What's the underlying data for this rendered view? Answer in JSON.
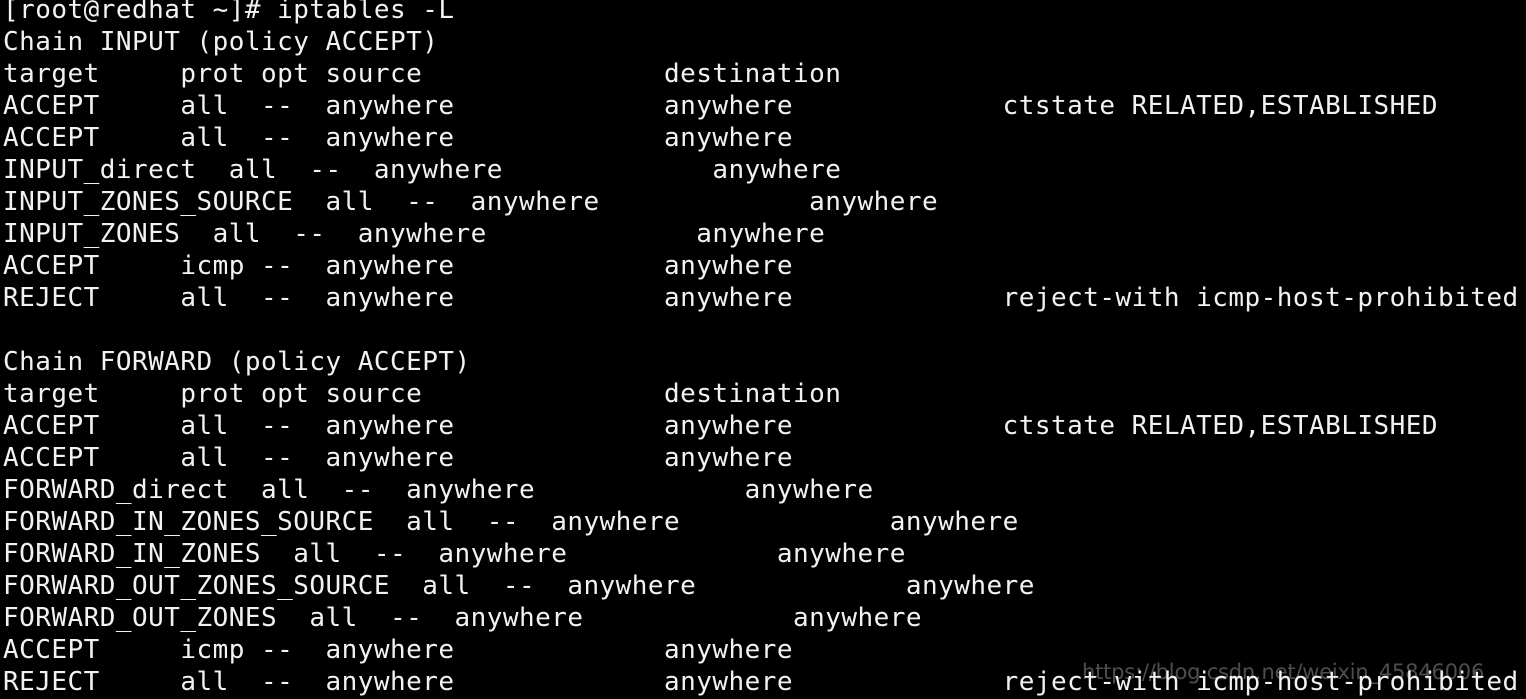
{
  "terminal": {
    "background_color": "#000000",
    "text_color": "#f2f2f2",
    "prompt": "[root@redhat ~]#",
    "command": "iptables -L",
    "lines": [
      "[root@redhat ~]# iptables -L",
      "Chain INPUT (policy ACCEPT)",
      "target     prot opt source               destination         ",
      "ACCEPT     all  --  anywhere             anywhere             ctstate RELATED,ESTABLISHED",
      "ACCEPT     all  --  anywhere             anywhere            ",
      "INPUT_direct  all  --  anywhere             anywhere          ",
      "INPUT_ZONES_SOURCE  all  --  anywhere             anywhere    ",
      "INPUT_ZONES  all  --  anywhere             anywhere           ",
      "ACCEPT     icmp --  anywhere             anywhere            ",
      "REJECT     all  --  anywhere             anywhere             reject-with icmp-host-prohibited",
      "",
      "Chain FORWARD (policy ACCEPT)",
      "target     prot opt source               destination         ",
      "ACCEPT     all  --  anywhere             anywhere             ctstate RELATED,ESTABLISHED",
      "ACCEPT     all  --  anywhere             anywhere            ",
      "FORWARD_direct  all  --  anywhere             anywhere        ",
      "FORWARD_IN_ZONES_SOURCE  all  --  anywhere             anywhere",
      "FORWARD_IN_ZONES  all  --  anywhere             anywhere      ",
      "FORWARD_OUT_ZONES_SOURCE  all  --  anywhere             anywhere",
      "FORWARD_OUT_ZONES  all  --  anywhere             anywhere     ",
      "ACCEPT     icmp --  anywhere             anywhere            ",
      "REJECT     all  --  anywhere             anywhere             reject-with icmp-host-prohibited"
    ],
    "columns": [
      "target",
      "prot",
      "opt",
      "source",
      "destination"
    ],
    "chains": [
      {
        "name": "INPUT",
        "policy": "ACCEPT",
        "rules": [
          {
            "target": "ACCEPT",
            "prot": "all",
            "opt": "--",
            "source": "anywhere",
            "destination": "anywhere",
            "extra": "ctstate RELATED,ESTABLISHED"
          },
          {
            "target": "ACCEPT",
            "prot": "all",
            "opt": "--",
            "source": "anywhere",
            "destination": "anywhere",
            "extra": ""
          },
          {
            "target": "INPUT_direct",
            "prot": "all",
            "opt": "--",
            "source": "anywhere",
            "destination": "anywhere",
            "extra": ""
          },
          {
            "target": "INPUT_ZONES_SOURCE",
            "prot": "all",
            "opt": "--",
            "source": "anywhere",
            "destination": "anywhere",
            "extra": ""
          },
          {
            "target": "INPUT_ZONES",
            "prot": "all",
            "opt": "--",
            "source": "anywhere",
            "destination": "anywhere",
            "extra": ""
          },
          {
            "target": "ACCEPT",
            "prot": "icmp",
            "opt": "--",
            "source": "anywhere",
            "destination": "anywhere",
            "extra": ""
          },
          {
            "target": "REJECT",
            "prot": "all",
            "opt": "--",
            "source": "anywhere",
            "destination": "anywhere",
            "extra": "reject-with icmp-host-prohibited"
          }
        ]
      },
      {
        "name": "FORWARD",
        "policy": "ACCEPT",
        "rules": [
          {
            "target": "ACCEPT",
            "prot": "all",
            "opt": "--",
            "source": "anywhere",
            "destination": "anywhere",
            "extra": "ctstate RELATED,ESTABLISHED"
          },
          {
            "target": "ACCEPT",
            "prot": "all",
            "opt": "--",
            "source": "anywhere",
            "destination": "anywhere",
            "extra": ""
          },
          {
            "target": "FORWARD_direct",
            "prot": "all",
            "opt": "--",
            "source": "anywhere",
            "destination": "anywhere",
            "extra": ""
          },
          {
            "target": "FORWARD_IN_ZONES_SOURCE",
            "prot": "all",
            "opt": "--",
            "source": "anywhere",
            "destination": "anywhere",
            "extra": ""
          },
          {
            "target": "FORWARD_IN_ZONES",
            "prot": "all",
            "opt": "--",
            "source": "anywhere",
            "destination": "anywhere",
            "extra": ""
          },
          {
            "target": "FORWARD_OUT_ZONES_SOURCE",
            "prot": "all",
            "opt": "--",
            "source": "anywhere",
            "destination": "anywhere",
            "extra": ""
          },
          {
            "target": "FORWARD_OUT_ZONES",
            "prot": "all",
            "opt": "--",
            "source": "anywhere",
            "destination": "anywhere",
            "extra": ""
          },
          {
            "target": "ACCEPT",
            "prot": "icmp",
            "opt": "--",
            "source": "anywhere",
            "destination": "anywhere",
            "extra": ""
          },
          {
            "target": "REJECT",
            "prot": "all",
            "opt": "--",
            "source": "anywhere",
            "destination": "anywhere",
            "extra": "reject-with icmp-host-prohibited"
          }
        ]
      }
    ]
  },
  "watermark": {
    "text": "https://blog.csdn.net/weixin_45846006",
    "color": "#ffffff",
    "opacity": "0.30"
  }
}
